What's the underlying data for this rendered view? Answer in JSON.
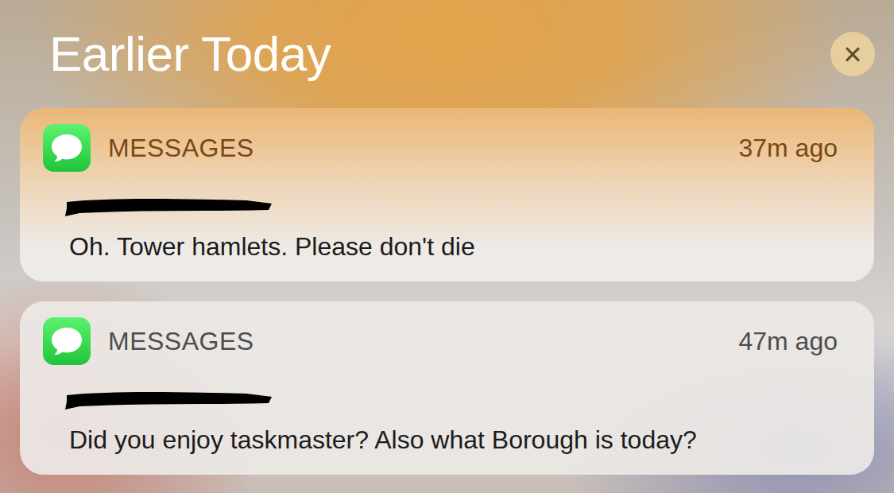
{
  "section": {
    "title": "Earlier Today",
    "close": "×"
  },
  "notifications": [
    {
      "app": "MESSAGES",
      "time": "37m ago",
      "sender_redacted": true,
      "message": "Oh. Tower hamlets. Please don't die"
    },
    {
      "app": "MESSAGES",
      "time": "47m ago",
      "sender_redacted": true,
      "message": "Did you enjoy taskmaster? Also what Borough is today?"
    }
  ]
}
